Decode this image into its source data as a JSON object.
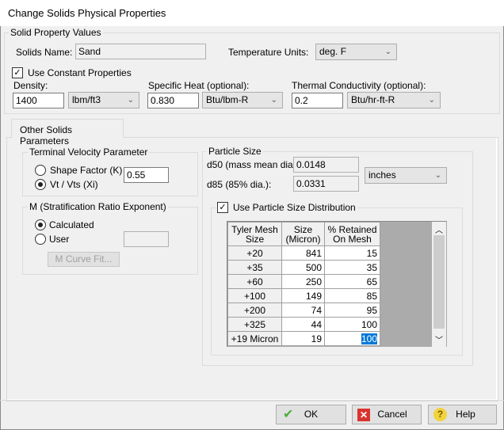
{
  "window": {
    "title": "Change Solids Physical Properties"
  },
  "solid_props": {
    "group_label": "Solid Property Values",
    "name_label": "Solids Name:",
    "name_value": "Sand",
    "temp_units_label": "Temperature Units:",
    "temp_units_value": "deg. F",
    "use_constant_label": "Use Constant Properties",
    "use_constant_checked": true,
    "density_label": "Density:",
    "density_value": "1400",
    "density_unit": "lbm/ft3",
    "specific_heat_label": "Specific Heat (optional):",
    "specific_heat_value": "0.830",
    "specific_heat_unit": "Btu/lbm-R",
    "thermal_label": "Thermal Conductivity (optional):",
    "thermal_value": "0.2",
    "thermal_unit": "Btu/hr-ft-R"
  },
  "tabs": [
    {
      "label": "Other Solids Parameters",
      "active": true
    }
  ],
  "terminal": {
    "group_label": "Terminal Velocity Parameter",
    "opt_shape": "Shape Factor (K)",
    "opt_vt": "Vt / Vts (Xi)",
    "selected": "Vt / Vts (Xi)",
    "value": "0.55"
  },
  "m_exp": {
    "group_label": "M (Stratification Ratio Exponent)",
    "opt_calc": "Calculated",
    "opt_user": "User",
    "selected": "Calculated",
    "user_value": "",
    "curve_fit_label": "M Curve Fit..."
  },
  "particle": {
    "group_label": "Particle Size",
    "d50_label": "d50 (mass mean dia.):",
    "d50_value": "0.0148",
    "d85_label": "d85 (85% dia.):",
    "d85_value": "0.0331",
    "unit": "inches",
    "psd_label": "Use Particle Size Distribution",
    "psd_checked": true,
    "columns": [
      "Tyler Mesh Size",
      "Size (Micron)",
      "% Retained On Mesh"
    ],
    "rows": [
      [
        "+20",
        "841",
        "15"
      ],
      [
        "+35",
        "500",
        "35"
      ],
      [
        "+60",
        "250",
        "65"
      ],
      [
        "+100",
        "149",
        "85"
      ],
      [
        "+200",
        "74",
        "95"
      ],
      [
        "+325",
        "44",
        "100"
      ],
      [
        "+19 Micron",
        "19",
        "100"
      ]
    ]
  },
  "buttons": {
    "ok": "OK",
    "cancel": "Cancel",
    "help": "Help"
  }
}
